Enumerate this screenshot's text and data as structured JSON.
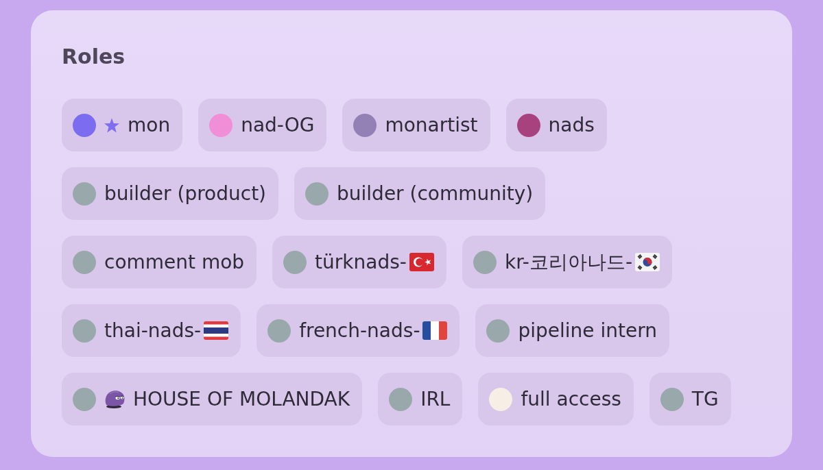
{
  "panel": {
    "title": "Roles",
    "roles": [
      {
        "name": "mon",
        "color": "#7b6cf0",
        "kind": "starred"
      },
      {
        "name": "nad-OG",
        "color": "#f08fd8",
        "kind": "plain"
      },
      {
        "name": "monartist",
        "color": "#9380b4",
        "kind": "plain"
      },
      {
        "name": "nads",
        "color": "#a8427e",
        "kind": "plain"
      },
      {
        "name": "builder (product)",
        "color": "#99a8ab",
        "kind": "plain"
      },
      {
        "name": "builder (community)",
        "color": "#99a8ab",
        "kind": "plain"
      },
      {
        "name": "comment mob",
        "color": "#99a8ab",
        "kind": "plain"
      },
      {
        "name": "türknads-",
        "color": "#99a8ab",
        "kind": "turkish"
      },
      {
        "name": "kr-코리아나드-",
        "color": "#99a8ab",
        "kind": "korean"
      },
      {
        "name": "thai-nads-",
        "color": "#99a8ab",
        "kind": "thai"
      },
      {
        "name": "french-nads-",
        "color": "#99a8ab",
        "kind": "french"
      },
      {
        "name": "pipeline intern",
        "color": "#99a8ab",
        "kind": "plain"
      },
      {
        "name": "HOUSE OF MOLANDAK",
        "color": "#99a8ab",
        "kind": "mascot"
      },
      {
        "name": "IRL",
        "color": "#99a8ab",
        "kind": "plain"
      },
      {
        "name": "full access",
        "color": "#f7efe6",
        "kind": "plain"
      },
      {
        "name": "TG",
        "color": "#99a8ab",
        "kind": "plain"
      }
    ]
  }
}
